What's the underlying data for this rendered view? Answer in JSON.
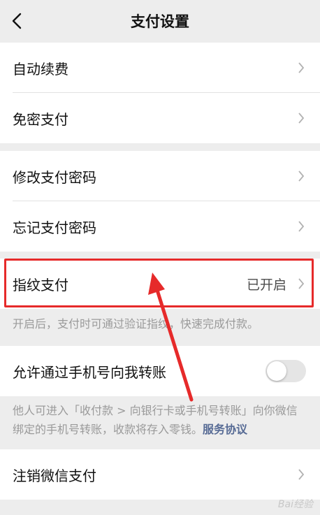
{
  "header": {
    "title": "支付设置"
  },
  "group1": [
    {
      "label": "自动续费"
    },
    {
      "label": "免密支付"
    }
  ],
  "group2": [
    {
      "label": "修改支付密码"
    },
    {
      "label": "忘记支付密码"
    }
  ],
  "fingerprint": {
    "label": "指纹支付",
    "value": "已开启"
  },
  "fingerprint_hint": "开启后，支付时可通过验证指纹，快速完成付款。",
  "phone_transfer": {
    "label": "允许通过手机号向我转账",
    "enabled": false
  },
  "phone_hint": {
    "text": "他人可进入「收付款 > 向银行卡或手机号转账」向你微信绑定的手机号转账，收款将存入零钱。",
    "link": "服务协议"
  },
  "cancel": {
    "label": "注销微信支付"
  },
  "colors": {
    "highlight": "#e62a2a",
    "link": "#576b95"
  },
  "watermark": "Bai经验"
}
